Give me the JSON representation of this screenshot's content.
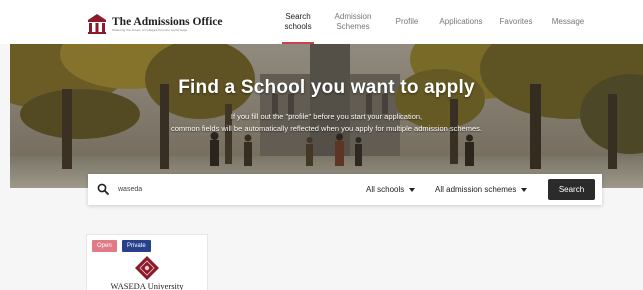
{
  "header": {
    "logo_title": "The Admissions Office",
    "logo_tagline": "Widening the choice of colleges from the world stage",
    "nav": [
      {
        "lines": [
          "Search",
          "schools"
        ],
        "active": true
      },
      {
        "lines": [
          "Admission",
          "Schemes"
        ],
        "active": false
      },
      {
        "lines": [
          "Profile"
        ],
        "active": false
      },
      {
        "lines": [
          "Applications"
        ],
        "active": false
      },
      {
        "lines": [
          "Favorites"
        ],
        "active": false
      },
      {
        "lines": [
          "Message"
        ],
        "active": false
      }
    ]
  },
  "hero": {
    "title": "Find a School you want to apply",
    "subtitle_line1": "If you fill out the \"profile\" before you start your application,",
    "subtitle_line2": "common fields will be automatically reflected when you apply for multiple admission schemes."
  },
  "search": {
    "query": "waseda",
    "school_filter": "All schools",
    "scheme_filter": "All admission schemes",
    "button_label": "Search"
  },
  "results": [
    {
      "badges": [
        "Open",
        "Private"
      ],
      "name": "WASEDA University"
    }
  ],
  "colors": {
    "accent": "#c8434a",
    "badge_open": "#e07a86",
    "badge_private": "#27408b",
    "button": "#2b2b2b",
    "emblem": "#8b1a2b"
  }
}
